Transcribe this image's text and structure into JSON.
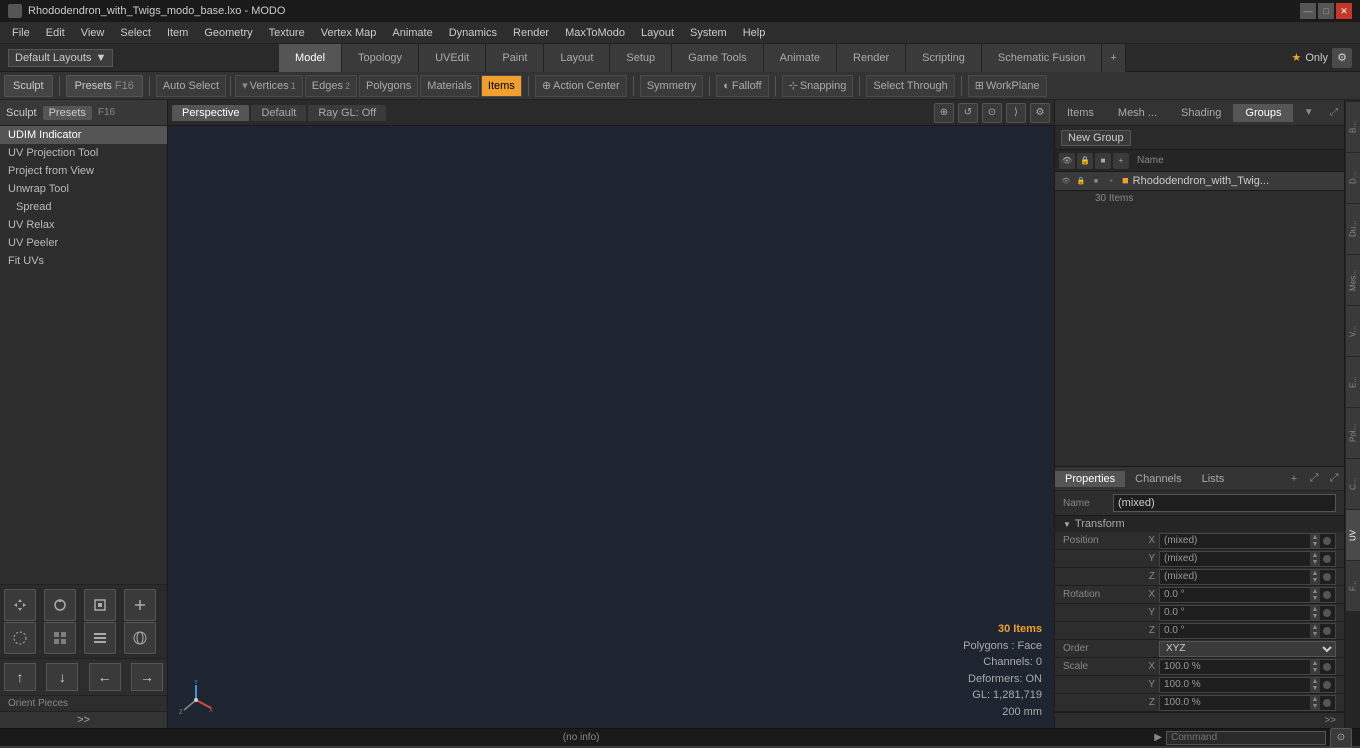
{
  "window": {
    "title": "Rhododendron_with_Twigs_modo_base.lxo - MODO"
  },
  "titlebar": {
    "minimize": "—",
    "maximize": "□",
    "close": "✕"
  },
  "menubar": {
    "items": [
      "File",
      "Edit",
      "View",
      "Select",
      "Item",
      "Geometry",
      "Texture",
      "Vertex Map",
      "Animate",
      "Dynamics",
      "Render",
      "MaxToModo",
      "Layout",
      "System",
      "Help"
    ]
  },
  "layoutbar": {
    "layouts_label": "Default Layouts",
    "tabs": [
      "Model",
      "Topology",
      "UVEdit",
      "Paint",
      "Layout",
      "Setup",
      "Game Tools",
      "Animate",
      "Render",
      "Scripting",
      "Schematic Fusion"
    ],
    "active_tab": "Model",
    "add_btn": "+",
    "star_only": "★  Only"
  },
  "toolbar": {
    "sculpt_label": "Sculpt",
    "presets_label": "Presets",
    "presets_key": "F16",
    "auto_select": "Auto Select",
    "vertices": "Vertices",
    "vertices_count": "1",
    "edges": "Edges",
    "edges_count": "2",
    "polygons": "Polygons",
    "materials": "Materials",
    "items": "Items",
    "action_center": "Action Center",
    "symmetry": "Symmetry",
    "falloff": "Falloff",
    "snapping": "Snapping",
    "select_through": "Select Through",
    "workplane": "WorkPlane"
  },
  "left_panel": {
    "tools": [
      "UDIM Indicator",
      "UV Projection Tool",
      "Project from View",
      "Unwrap Tool",
      "Spread",
      "UV Relax",
      "UV Peeler",
      "Fit UVs"
    ],
    "orient_pieces": "Orient Pieces",
    "more_btn": ">>"
  },
  "viewport": {
    "tabs": [
      "Perspective",
      "Default",
      "Ray GL: Off"
    ],
    "active_tab": "Perspective",
    "controls": [
      "⊕",
      "↺",
      "⊙",
      "⟩",
      "⚙"
    ],
    "info": {
      "items_count": "30 Items",
      "polygons_label": "Polygons : Face",
      "channels": "Channels: 0",
      "deformers": "Deformers: ON",
      "gl": "GL: 1,281,719",
      "scale": "200 mm"
    }
  },
  "right_panel": {
    "top_tabs": [
      "Items",
      "Mesh ...",
      "Shading",
      "Groups"
    ],
    "active_top_tab": "Groups",
    "new_group": "New Group",
    "header_cols": [
      "Name"
    ],
    "groups": [
      {
        "name": "Rhododendron_with_Twig...",
        "count": "30 Items"
      }
    ],
    "props_tabs": [
      "Properties",
      "Channels",
      "Lists"
    ],
    "active_props_tab": "Properties",
    "name_label": "Name",
    "name_value": "(mixed)",
    "transform_label": "Transform",
    "position": {
      "label": "Position",
      "x": "(mixed)",
      "y": "(mixed)",
      "z": "(mixed)"
    },
    "rotation": {
      "label": "Rotation",
      "x": "0.0 °",
      "y": "0.0 °",
      "z": "0.0 °"
    },
    "order": {
      "label": "Order",
      "value": "XYZ"
    },
    "scale": {
      "label": "Scale",
      "x": "100.0 %",
      "y": "100.0 %",
      "z": "100.0 %"
    }
  },
  "side_strip": {
    "items": [
      "B...",
      "D...",
      "Du...",
      "Mes...",
      "V...",
      "E...",
      "Pol...",
      "C...",
      "UV",
      "F..."
    ]
  },
  "statusbar": {
    "info": "(no info)",
    "cmd_label": "Command"
  },
  "colors": {
    "accent": "#f0a030",
    "active_bg": "#555555",
    "panel_bg": "#2d2d2d",
    "dark_bg": "#1e1e1e",
    "viewport_bg": "#1e2530"
  }
}
